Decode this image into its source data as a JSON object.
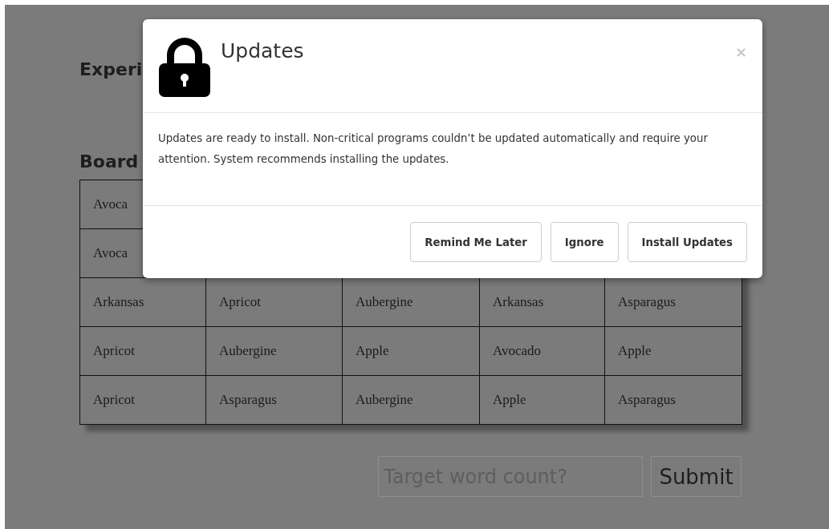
{
  "page": {
    "heading": "Experi",
    "board_heading": "Board",
    "board_rows": [
      [
        "Avoca"
      ],
      [
        "Avoca"
      ],
      [
        "Arkansas",
        "Apricot",
        "Aubergine",
        "Arkansas",
        "Asparagus"
      ],
      [
        "Apricot",
        "Aubergine",
        "Apple",
        "Avocado",
        "Apple"
      ],
      [
        "Apricot",
        "Asparagus",
        "Aubergine",
        "Apple",
        "Asparagus"
      ]
    ],
    "target_field": {
      "placeholder": "Target word count?"
    },
    "submit_button": "Submit"
  },
  "modal": {
    "title": "Updates",
    "close": "×",
    "message": "Updates are ready to install. Non-critical programs couldn’t be updated automatically and require your attention. System recommends installing the updates.",
    "buttons": [
      "Remind Me Later",
      "Ignore",
      "Install Updates"
    ]
  }
}
